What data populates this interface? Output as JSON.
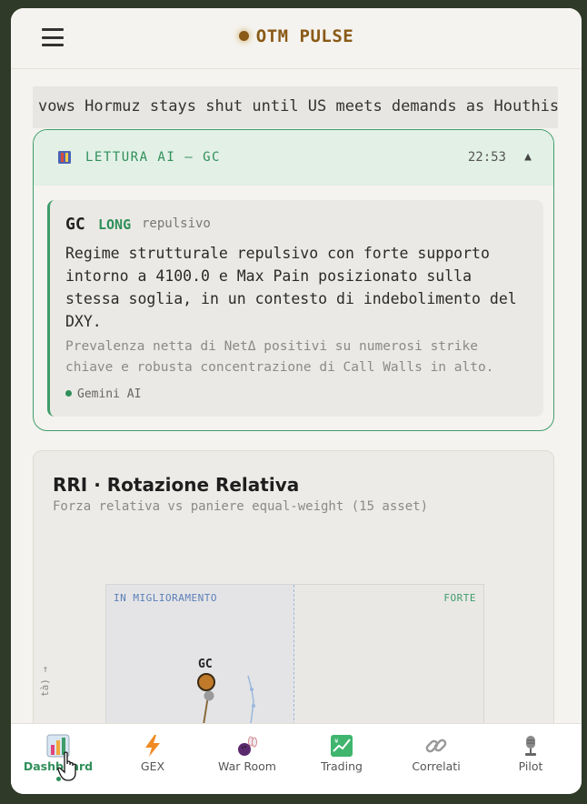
{
  "header": {
    "app_title": "OTM PULSE"
  },
  "ticker": {
    "text": "vows Hormuz stays shut until US meets demands as Houthis w"
  },
  "ai_card": {
    "title": "LETTURA AI — GC",
    "time": "22:53",
    "caret": "▲",
    "symbol": "GC",
    "direction": "LONG",
    "regime": "repulsivo",
    "summary": "Regime strutturale repulsivo con forte supporto intorno a 4100.0 e Max Pain posizionato sulla stessa soglia, in un contesto di indebolimento del DXY.",
    "detail": "Prevalenza netta di NetΔ positivi su numerosi strike chiave e robusta concentrazione di Call Walls in alto.",
    "source": "Gemini AI"
  },
  "rri": {
    "title": "RRI · Rotazione Relativa",
    "subtitle": "Forza relativa vs paniere equal-weight (15 asset)",
    "quadrant_left_label": "IN MIGLIORAMENTO",
    "quadrant_right_label": "FORTE",
    "point_label": "GC",
    "y_axis_label_fragment": "tà) →"
  },
  "nav": {
    "items": [
      {
        "label": "Dashboard",
        "icon": "bar-chart-icon",
        "active": true
      },
      {
        "label": "GEX",
        "icon": "lightning-icon",
        "active": false
      },
      {
        "label": "War Room",
        "icon": "bowling-icon",
        "active": false
      },
      {
        "label": "Trading",
        "icon": "trend-chart-icon",
        "active": false
      },
      {
        "label": "Correlati",
        "icon": "chain-link-icon",
        "active": false
      },
      {
        "label": "Pilot",
        "icon": "microphone-icon",
        "active": false
      }
    ]
  },
  "colors": {
    "accent_green": "#2f8f5a",
    "brand_brown": "#8a5a17",
    "quadrant_blue": "#5b7fb8"
  }
}
